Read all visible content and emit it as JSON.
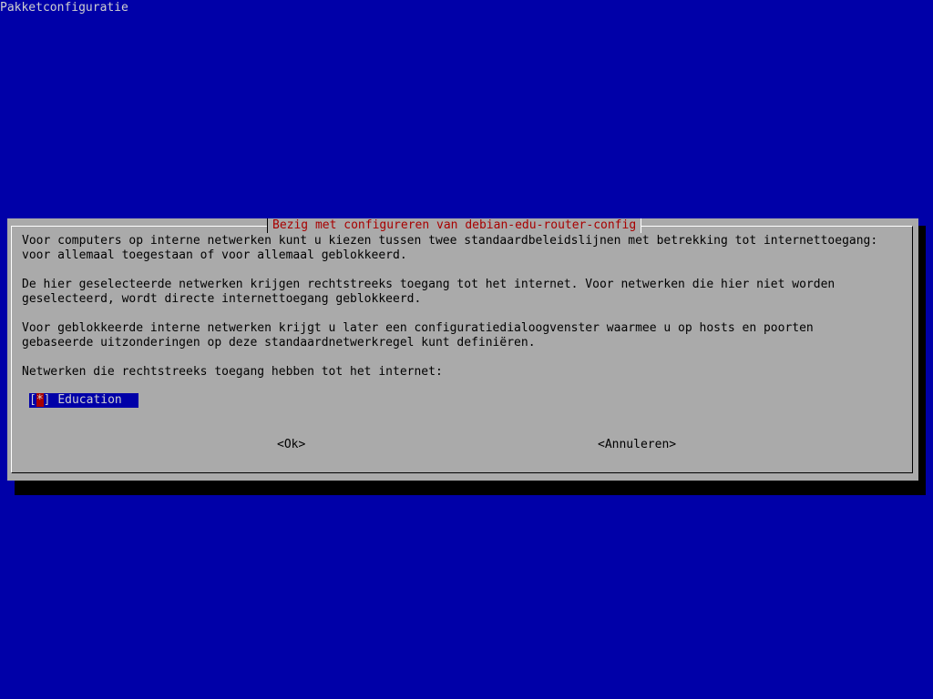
{
  "screen": {
    "title": "Pakketconfiguratie"
  },
  "dialog": {
    "title": "Bezig met configureren van debian-edu-router-config",
    "paragraphs": {
      "p1_line1": "Voor computers op interne netwerken kunt u kiezen tussen twee standaardbeleidslijnen met betrekking tot internettoegang:",
      "p1_line2": "voor allemaal toegestaan of voor allemaal geblokkeerd.",
      "p2_line1": "De hier geselecteerde netwerken krijgen rechtstreeks toegang tot het internet. Voor netwerken die hier niet worden",
      "p2_line2": "geselecteerd, wordt directe internettoegang geblokkeerd.",
      "p3_line1": "Voor geblokkeerde interne netwerken krijgt u later een configuratiedialoogvenster waarmee u op hosts en poorten",
      "p3_line2": "gebaseerde uitzonderingen op deze standaardnetwerkregel kunt definiëren.",
      "prompt": "Netwerken die rechtstreeks toegang hebben tot het internet:"
    },
    "checklist": {
      "open_bracket": "[",
      "mark": "*",
      "close_bracket": "]",
      "label": "Education"
    },
    "buttons": {
      "ok": "<Ok>",
      "cancel": "<Annuleren>"
    }
  },
  "colors": {
    "background": "#0000a8",
    "dialog": "#aaaaaa",
    "title_text": "#a80000",
    "selection": "#0000a8",
    "cursor": "#a80000"
  }
}
